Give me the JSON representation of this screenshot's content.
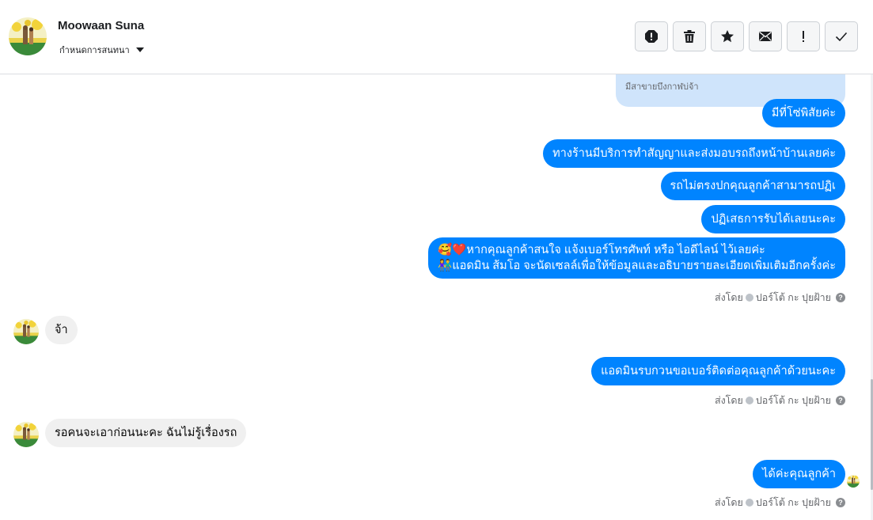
{
  "header": {
    "contact_name": "Moowaan Suna",
    "assign_label": "กำหนดการสนทนา"
  },
  "toolbar": {
    "buttons": [
      {
        "icon": "alert-circle-icon",
        "name": "mark-spam-button"
      },
      {
        "icon": "trash-icon",
        "name": "delete-button"
      },
      {
        "icon": "star-icon",
        "name": "star-button"
      },
      {
        "icon": "envelope-icon",
        "name": "mark-unread-button"
      },
      {
        "icon": "exclamation-icon",
        "name": "follow-up-button"
      },
      {
        "icon": "checkmark-icon",
        "name": "mark-done-button"
      }
    ]
  },
  "messages": {
    "quoted_snippet": "มีสาขายบึงกาฬบ่จ้า",
    "m1": "มีที่โซ่พิสัยค่ะ",
    "m2": "ทางร้านมีบริการทำสัญญาและส่งมอบรถถึงหน้าบ้านเลยค่ะ",
    "m3": "รถไม่ตรงปกคุณลูกค้าสามารถปฏิเ",
    "m4": "ปฏิเสธการรับได้เลยนะคะ",
    "m5_line1": "🥰❤️หากคุณลูกค้าสนใจ แจ้งเบอร์โทรศัพท์ หรือ ไอดีไลน์  ไว้เลยค่ะ",
    "m5_line2": "👫แอดมิน ส้มโอ จะนัดเซลล์เพื่อให้ข้อมูลและอธิบายรายละเอียดเพิ่มเติมอีกครั้งค่ะ",
    "in1": "จ้า",
    "m6": "แอดมินรบกวนขอเบอร์ติดต่อคุณลูกค้าด้วยนะคะ",
    "in2": "รอคนจะเอาก่อนนะคะ ฉันไม่รู้เรื่องรถ",
    "m7": "ได้ค่ะคุณลูกค้า"
  },
  "meta": {
    "sent_by_label": "ส่งโดย",
    "sender_name": "ปอร์โต้ กะ ปุยฝ้าย",
    "help_glyph": "?"
  },
  "colors": {
    "outgoing_bubble": "#0084ff",
    "incoming_bubble": "#f0f0f0",
    "quoted_bg": "#cfe4fb"
  }
}
